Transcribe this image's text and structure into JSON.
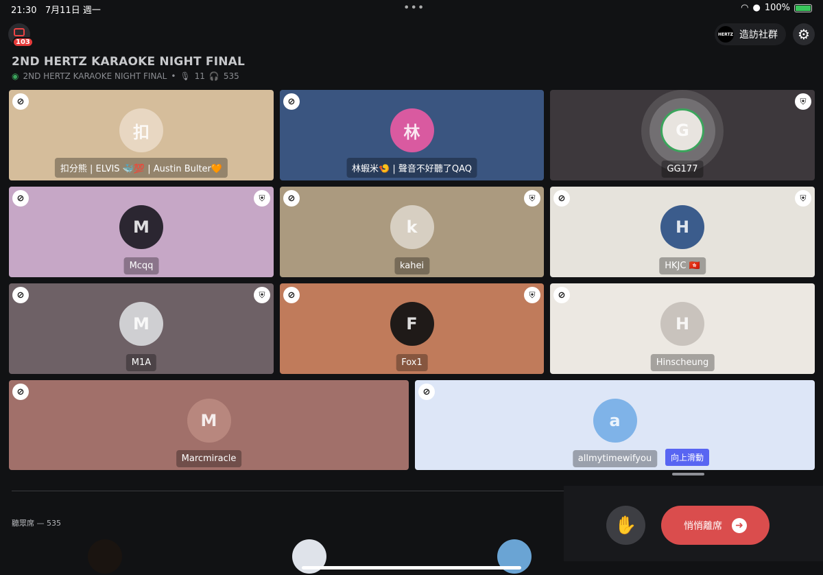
{
  "status_bar": {
    "time": "21:30",
    "date": "7月11日 週一",
    "battery": "100%",
    "wifi_icon": "wifi-icon",
    "person_icon": "person-icon"
  },
  "server": {
    "badge": "103"
  },
  "header": {
    "visit_label": "造訪社群",
    "visit_logo": "HERTZ"
  },
  "stage": {
    "title": "2ND HERTZ KARAOKE NIGHT FINAL",
    "subtitle": "2ND HERTZ KARAOKE NIGHT FINAL",
    "speakers_count": "11",
    "listeners_count": "535"
  },
  "speakers": [
    {
      "name": "扣分熊 | ELVIS 🐳💯 | Austin Bulter🧡",
      "bg": "#d5bd9b",
      "avatar_color": "#e8d7c2",
      "initial": "扣",
      "mod": false
    },
    {
      "name": "林蝦米🍤 | 聲音不好聽了QAQ",
      "bg": "#3a5580",
      "avatar_color": "#d95aa0",
      "initial": "林",
      "mod": false
    },
    {
      "name": "GG177",
      "bg": "#3d383c",
      "avatar_color": "#e8e4df",
      "initial": "G",
      "mod": true
    },
    {
      "name": "Mcqq",
      "bg": "#c6a7c6",
      "avatar_color": "#2b2631",
      "initial": "M",
      "mod": true
    },
    {
      "name": "kahei",
      "bg": "#ab9a7f",
      "avatar_color": "#d7cfc2",
      "initial": "k",
      "mod": true
    },
    {
      "name": "HKJC 🇭🇰",
      "bg": "#e6e3dc",
      "avatar_color": "#3b5c8c",
      "initial": "H",
      "mod": true
    },
    {
      "name": "M1A",
      "bg": "#6e6166",
      "avatar_color": "#cfcfd2",
      "initial": "M",
      "mod": true
    },
    {
      "name": "Fox1",
      "bg": "#c07b5b",
      "avatar_color": "#1f1a18",
      "initial": "F",
      "mod": true
    },
    {
      "name": "Hinscheung",
      "bg": "#ece8e2",
      "avatar_color": "#c9c3bd",
      "initial": "H",
      "mod": false
    },
    {
      "name": "Marcmiracle",
      "bg": "#a1706a",
      "avatar_color": "#b8877e",
      "initial": "M",
      "mod": false
    },
    {
      "name": "allmytimewifyou",
      "bg": "#dde6f7",
      "avatar_color": "#7fb3e8",
      "initial": "a",
      "mod": false
    }
  ],
  "audience": {
    "title": "聽眾席 — 535",
    "avatars": [
      {
        "color": "#1a1410"
      },
      {
        "color": "#dfe3ea"
      },
      {
        "color": "#6aa4d4"
      }
    ]
  },
  "scroll_tip": "向上滑動",
  "actions": {
    "raise_hand_icon": "hand-icon",
    "leave_label": "悄悄離席"
  }
}
